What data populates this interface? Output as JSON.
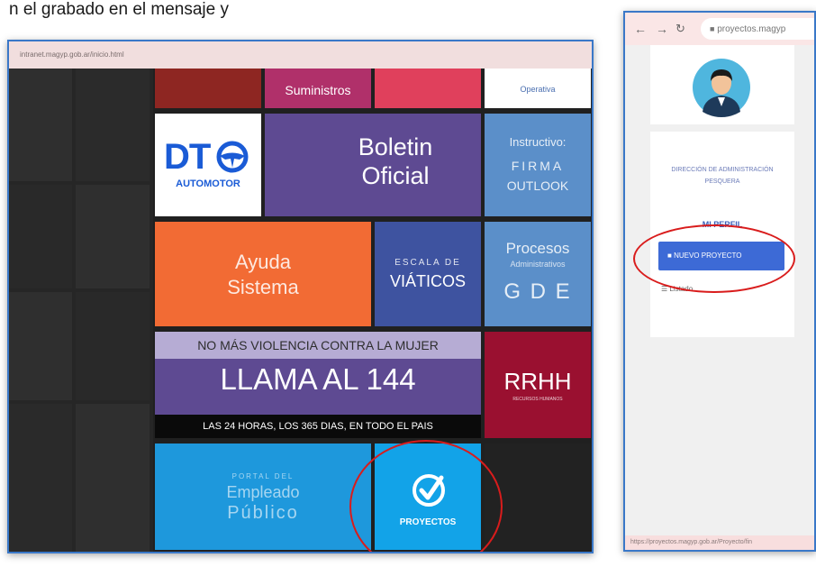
{
  "intro_text": "n el grabado en el mensaje  y",
  "left": {
    "url": "intranet.magyp.gob.ar/inicio.html",
    "tiles": {
      "suministros": "Suministros",
      "operativa": "Operativa",
      "dt_logo": "DT",
      "dt_automotor": "AUTOMOTOR",
      "boletin": "Boletin",
      "oficial": "Oficial",
      "instructivo": "Instructivo:",
      "firma": "FIRMA",
      "outlook": "OUTLOOK",
      "ayuda_line1": "Ayuda",
      "ayuda_line2": "Sistema",
      "escala": "ESCALA DE",
      "viaticos": "VIÁTICOS",
      "procesos": "Procesos",
      "administrativos": "Administrativos",
      "gde": "G D E",
      "violencia": "NO MÁS VIOLENCIA CONTRA LA MUJER",
      "llama": "LLAMA AL 144",
      "horas": "LAS 24 HORAS, LOS 365 DIAS, EN TODO EL PAIS",
      "rrhh": "RRHH",
      "rrhh_sub": "RECURSOS HUMANOS",
      "portal": "PORTAL DEL",
      "empleado": "Empleado",
      "publico": "Público",
      "proyectos": "PROYECTOS"
    },
    "colors": {
      "boletin": "#5e4a92",
      "ayuda": "#f26b34",
      "escala": "#3e53a0",
      "procesos": "#5b8fc9",
      "rrhh": "#9a1030",
      "portal": "#1e98dc",
      "proyectos": "#12a3e8"
    }
  },
  "right": {
    "url": "proyectos.magyp",
    "department": "DIRECCIÓN DE ADMINISTRACIÓN PESQUERA",
    "profile_link": "MI PERFIL",
    "new_project_button": "NUEVO PROYECTO",
    "list_link": "Listado",
    "status_url": "https://proyectos.magyp.gob.ar/Proyecto/fin"
  }
}
